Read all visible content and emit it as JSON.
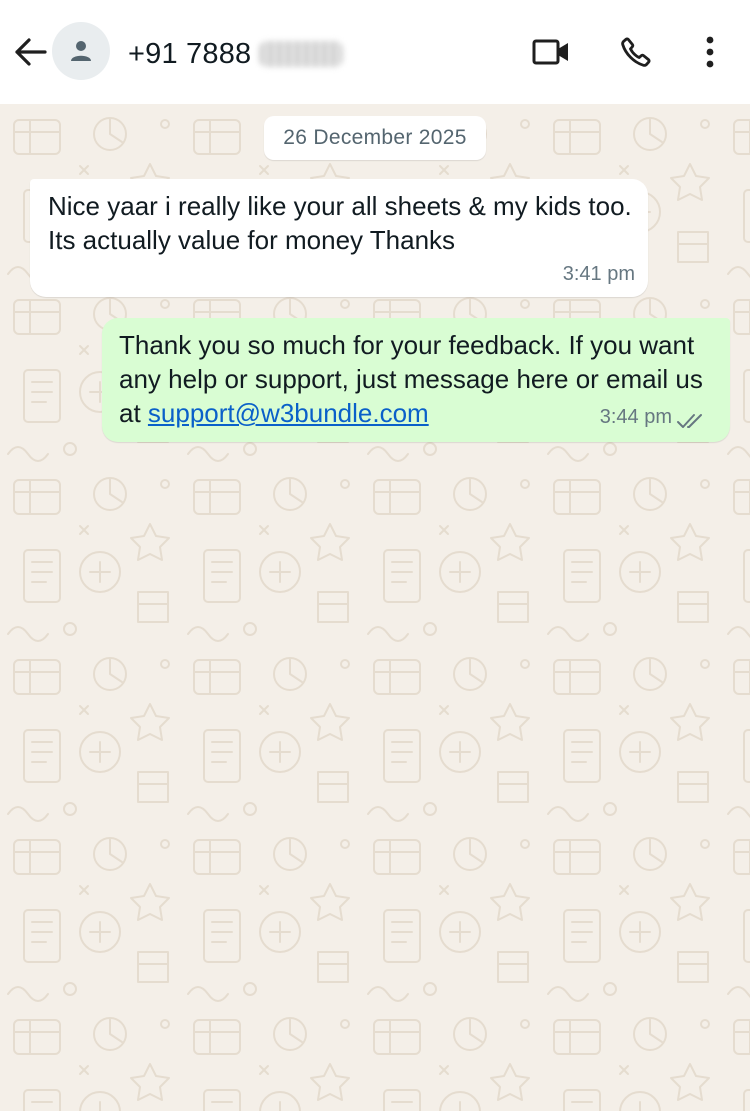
{
  "header": {
    "back_icon": "arrow-left-icon",
    "avatar_icon": "person-icon",
    "contact_name": "+91 7888",
    "contact_name_redacted": true,
    "video_icon": "video-camera-icon",
    "call_icon": "phone-icon",
    "menu_icon": "more-vertical-icon"
  },
  "chat": {
    "date_label": "26 December 2025",
    "messages": [
      {
        "direction": "incoming",
        "text": "Nice yaar i really like your all sheets & my kids too. Its actually value for money Thanks",
        "time": "3:41 pm"
      },
      {
        "direction": "outgoing",
        "text_before_link": "Thank you so much for your feedback. If you want any help or support, just message here or email us at ",
        "link": "support@w3bundle.com",
        "time": "3:44 pm",
        "status_icon": "double-check-icon"
      }
    ]
  },
  "colors": {
    "header_bg": "#ffffff",
    "chat_bg": "#f4efe8",
    "incoming_bubble": "#ffffff",
    "outgoing_bubble": "#d9fdd3",
    "link": "#0a60c9",
    "timestamp": "#667781"
  }
}
